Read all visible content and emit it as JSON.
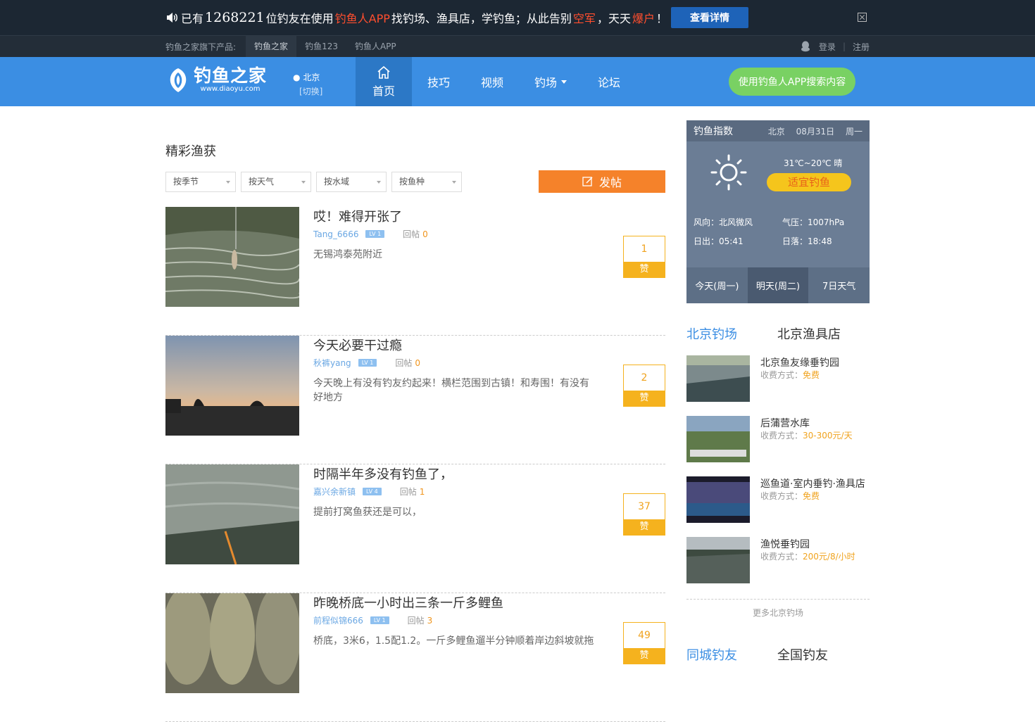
{
  "banner": {
    "prefix": "已有",
    "count": "1268221",
    "mid1": "位钓友在使用",
    "app": "钓鱼人APP",
    "mid2": "找钓场、渔具店，学钓鱼；从此告别",
    "word1": "空军",
    "mid3": "，天天",
    "word2": "爆户",
    "suffix": "！",
    "detail_button": "查看详情"
  },
  "prodbar": {
    "label": "钓鱼之家旗下产品:",
    "products": [
      "钓鱼之家",
      "钓鱼123",
      "钓鱼人APP"
    ],
    "login": "登录",
    "sep": "|",
    "register": "注册"
  },
  "nav": {
    "logo_cn": "钓鱼之家",
    "logo_en": "www.diaoyu.com",
    "city": "北京",
    "city_switch": "[切换]",
    "menu": [
      "首页",
      "技巧",
      "视频",
      "钓场",
      "论坛"
    ],
    "app_search": "使用钓鱼人APP搜索内容"
  },
  "main": {
    "section_title": "精彩渔获",
    "filters": [
      "按季节",
      "按天气",
      "按水域",
      "按鱼种"
    ],
    "post_button": "发帖",
    "posts": [
      {
        "title": "哎！难得开张了",
        "user": "Tang_6666",
        "level": "LV 1",
        "reply_label": "回帖",
        "replies": "0",
        "desc": "无锡鸿泰苑附近",
        "likes": "1",
        "like_label": "赞"
      },
      {
        "title": "今天必要干过瘾",
        "user": "秋裤yang",
        "level": "LV 1",
        "reply_label": "回帖",
        "replies": "0",
        "desc": "今天晚上有没有钓友约起来！横栏范围到古镇！和寿围！有没有好地方",
        "likes": "2",
        "like_label": "赞"
      },
      {
        "title": "时隔半年多没有钓鱼了，",
        "user": "嘉兴余新镇",
        "level": "LV 4",
        "reply_label": "回帖",
        "replies": "1",
        "desc": "提前打窝鱼获还是可以，",
        "likes": "37",
        "like_label": "赞"
      },
      {
        "title": "昨晚桥底一小时出三条一斤多鲤鱼",
        "user": "前程似锦666",
        "level": "LV 1",
        "reply_label": "回帖",
        "replies": "3",
        "desc": "桥底，3米6，1.5配1.2。一斤多鲤鱼遛半分钟顺着岸边斜坡就拖",
        "likes": "49",
        "like_label": "赞"
      }
    ]
  },
  "weather": {
    "title": "钓鱼指数",
    "city": "北京",
    "date": "08月31日",
    "weekday": "周一",
    "temp": "31℃~20℃ 晴",
    "fit": "适宜钓鱼",
    "wind": "风向：北风微风",
    "pressure": "气压：1007hPa",
    "sunrise": "日出：05:41",
    "sunset": "日落：18:48",
    "tabs": [
      "今天(周一)",
      "明天(周二)",
      "7日天气"
    ]
  },
  "spots": {
    "tab_active": "北京钓场",
    "tab_other": "北京渔具店",
    "fee_label": "收费方式：",
    "items": [
      {
        "name": "北京鱼友缘垂钓园",
        "fee": "免费"
      },
      {
        "name": "后蒲营水库",
        "fee": "30-300元/天"
      },
      {
        "name": "巡鱼道·室内垂钓·渔具店",
        "fee": "免费"
      },
      {
        "name": "渔悦垂钓园",
        "fee": "200元/8/小时"
      }
    ],
    "more": "更多北京钓场"
  },
  "friends": {
    "tab_active": "同城钓友",
    "tab_other": "全国钓友"
  }
}
